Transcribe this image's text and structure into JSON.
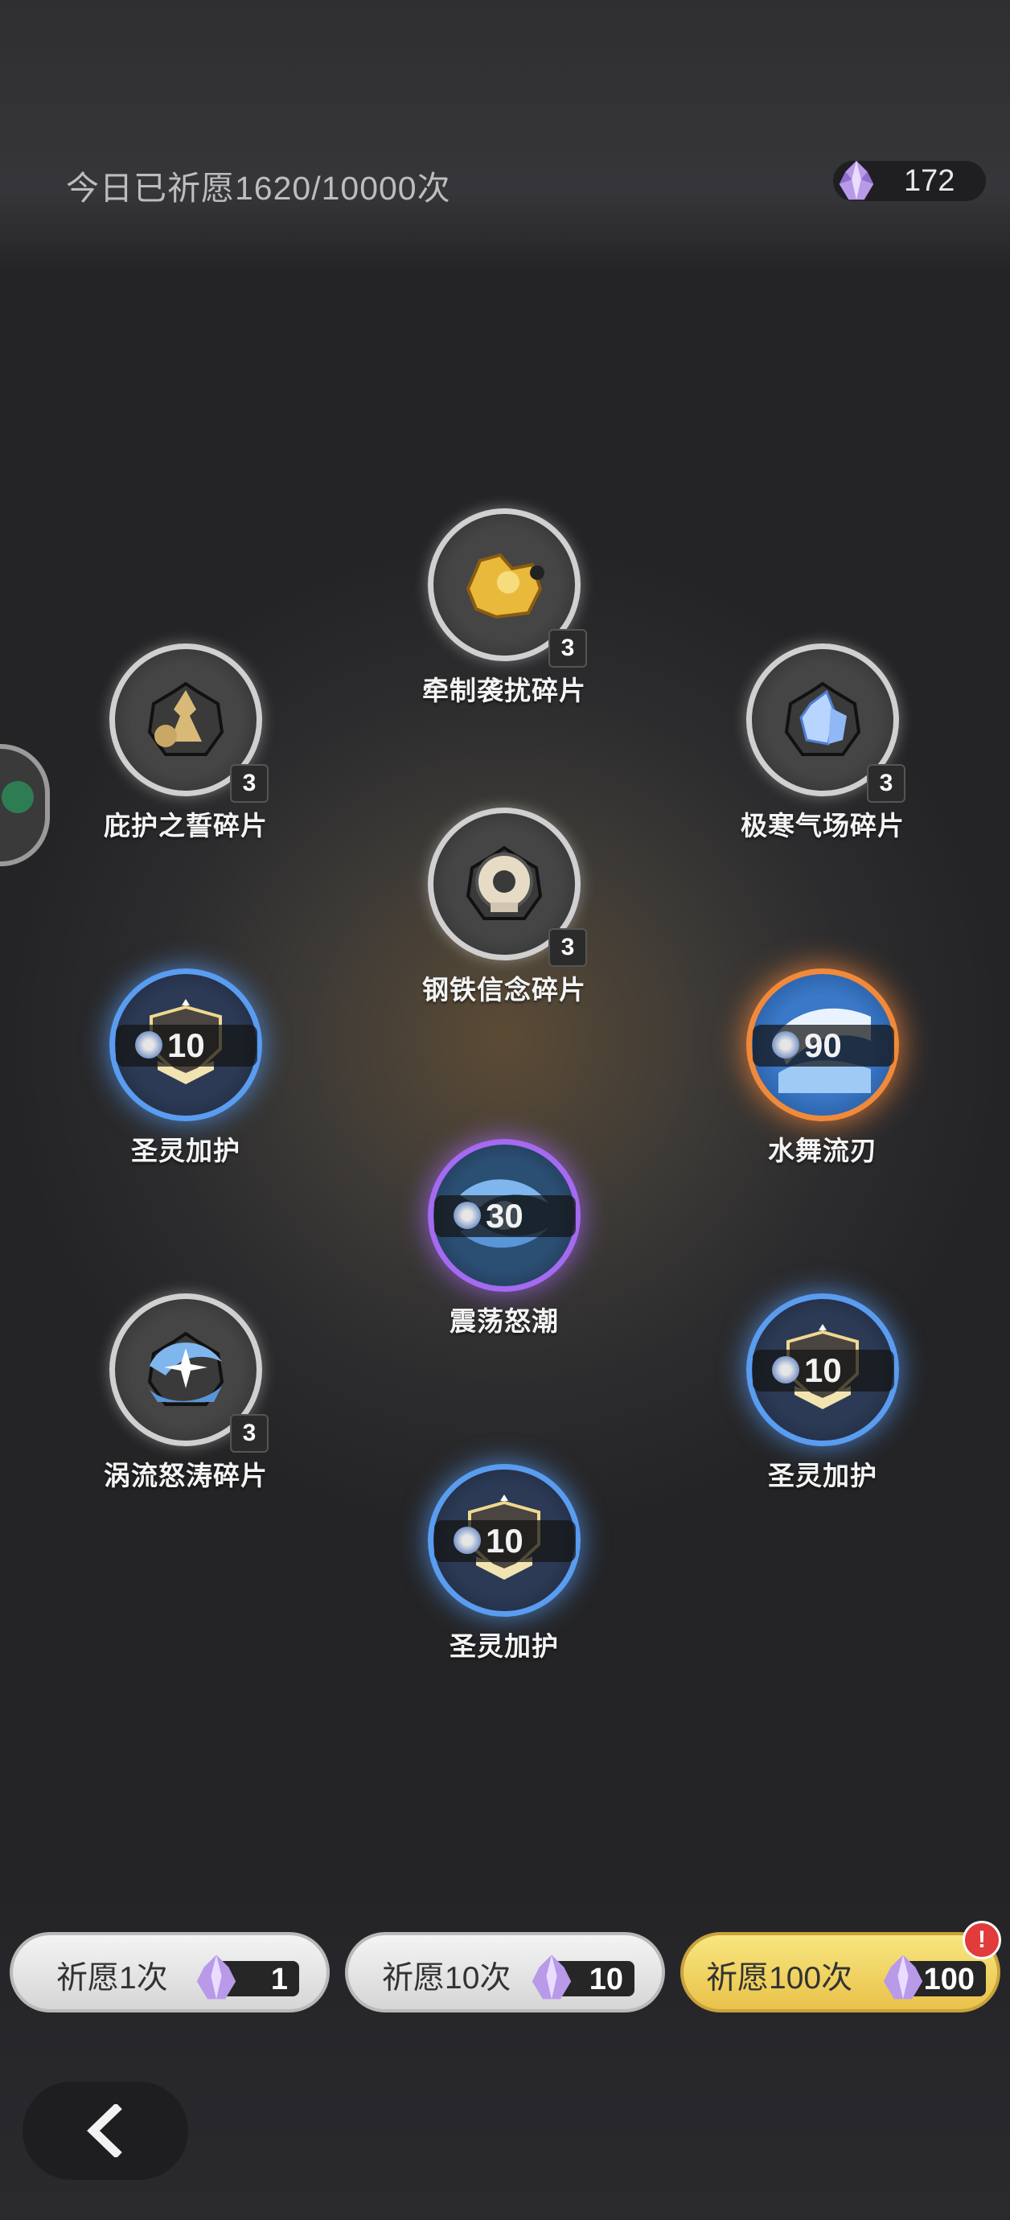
{
  "header": {
    "pray_count": "今日已祈愿1620/10000次",
    "currency_amount": "172",
    "currency_icon": "crystal-icon"
  },
  "rewards": [
    {
      "id": "top",
      "label": "牵制袭扰碎片",
      "quantity": "3",
      "type": "fragment",
      "tier": "gray"
    },
    {
      "id": "left-upper",
      "label": "庇护之誓碎片",
      "quantity": "3",
      "type": "fragment",
      "tier": "gray"
    },
    {
      "id": "right-upper",
      "label": "极寒气场碎片",
      "quantity": "3",
      "type": "fragment",
      "tier": "gray"
    },
    {
      "id": "center-upper",
      "label": "钢铁信念碎片",
      "quantity": "3",
      "type": "fragment",
      "tier": "gray"
    },
    {
      "id": "left-middle",
      "label": "圣灵加护",
      "quantity": "10",
      "type": "item",
      "tier": "blue"
    },
    {
      "id": "right-middle",
      "label": "水舞流刃",
      "quantity": "90",
      "type": "item",
      "tier": "orange"
    },
    {
      "id": "center",
      "label": "震荡怒潮",
      "quantity": "30",
      "type": "item",
      "tier": "purple"
    },
    {
      "id": "left-lower",
      "label": "涡流怒涛碎片",
      "quantity": "3",
      "type": "fragment",
      "tier": "gray"
    },
    {
      "id": "right-lower",
      "label": "圣灵加护",
      "quantity": "10",
      "type": "item",
      "tier": "blue"
    },
    {
      "id": "bottom",
      "label": "圣灵加护",
      "quantity": "10",
      "type": "item",
      "tier": "blue"
    }
  ],
  "buttons": {
    "pray_1": {
      "label": "祈愿1次",
      "cost": "1"
    },
    "pray_10": {
      "label": "祈愿10次",
      "cost": "10"
    },
    "pray_100": {
      "label": "祈愿100次",
      "cost": "100"
    },
    "alert_badge": "!"
  },
  "colors": {
    "gray_tier": "#d0d0d0",
    "blue_tier": "#5a9cf0",
    "purple_tier": "#a46af0",
    "orange_tier": "#f08a3a",
    "gold_button": "#f3d765",
    "alert": "#e23b3b"
  }
}
